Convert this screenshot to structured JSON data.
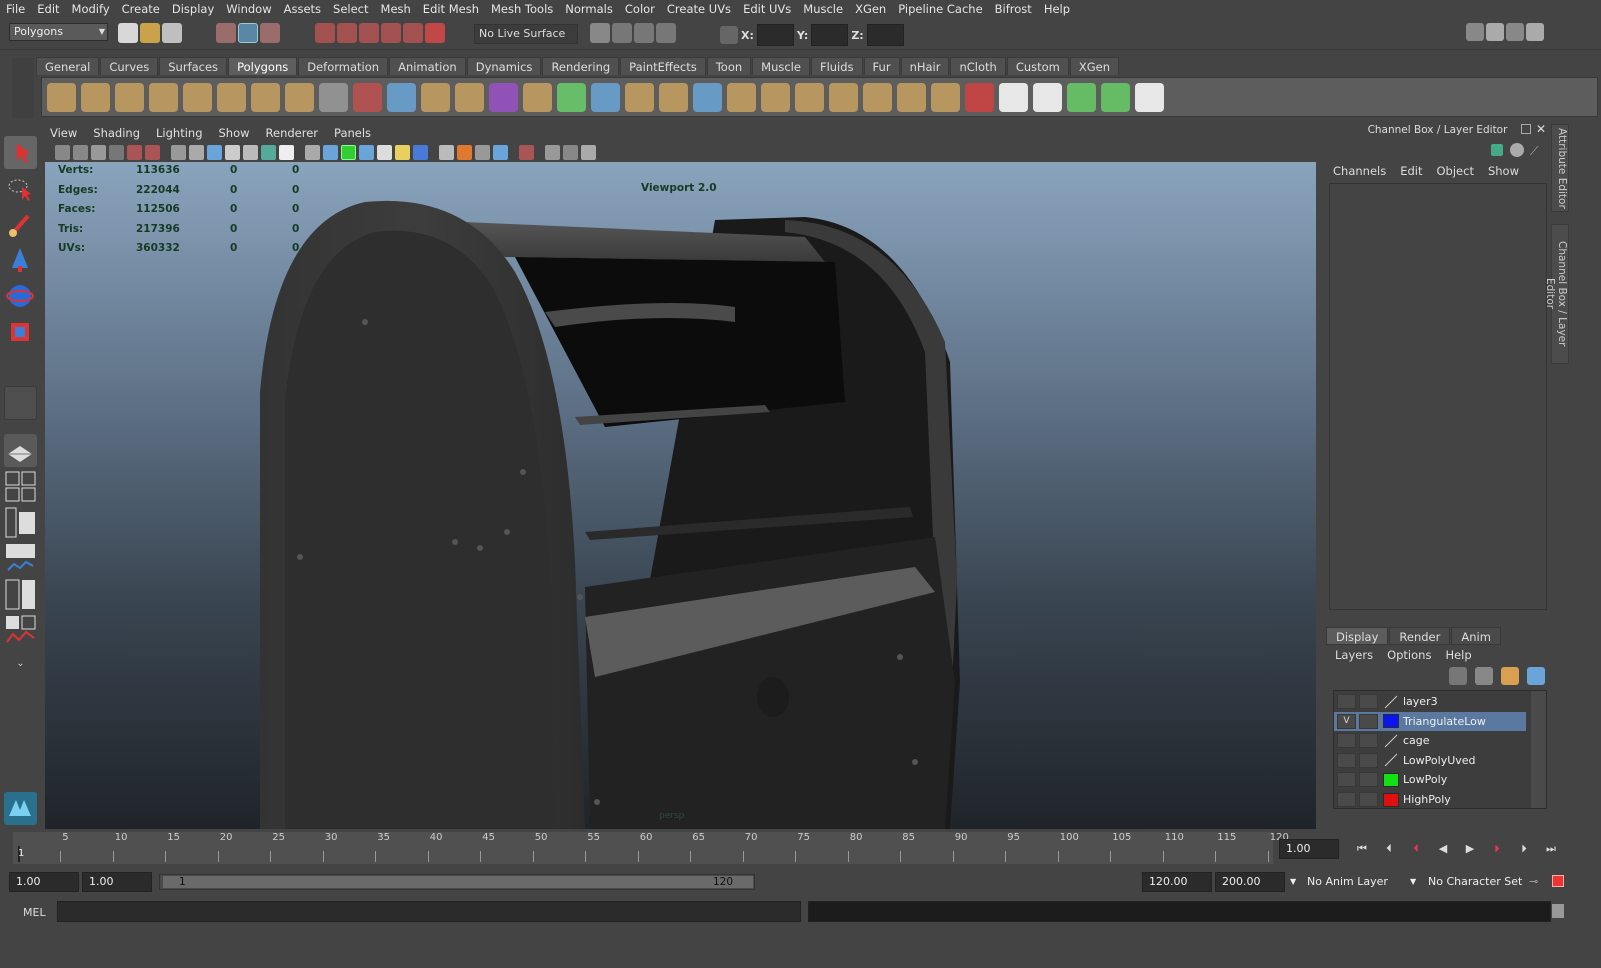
{
  "menubar": {
    "items": [
      "File",
      "Edit",
      "Modify",
      "Create",
      "Display",
      "Window",
      "Assets",
      "Select",
      "Mesh",
      "Edit Mesh",
      "Mesh Tools",
      "Normals",
      "Color",
      "Create UVs",
      "Edit UVs",
      "Muscle",
      "XGen",
      "Pipeline Cache",
      "Bifrost",
      "Help"
    ]
  },
  "statusline": {
    "mode": "Polygons",
    "live_surface": "No Live Surface",
    "x_label": "X:",
    "y_label": "Y:",
    "z_label": "Z:"
  },
  "shelf": {
    "tabs": [
      "General",
      "Curves",
      "Surfaces",
      "Polygons",
      "Deformation",
      "Animation",
      "Dynamics",
      "Rendering",
      "PaintEffects",
      "Toon",
      "Muscle",
      "Fluids",
      "Fur",
      "nHair",
      "nCloth",
      "Custom",
      "XGen"
    ],
    "active_tab": "Polygons"
  },
  "panel": {
    "menus": [
      "View",
      "Shading",
      "Lighting",
      "Show",
      "Renderer",
      "Panels"
    ]
  },
  "hud": {
    "rows": [
      {
        "label": "Verts:",
        "v1": "113636",
        "v2": "0",
        "v3": "0"
      },
      {
        "label": "Edges:",
        "v1": "222044",
        "v2": "0",
        "v3": "0"
      },
      {
        "label": "Faces:",
        "v1": "112506",
        "v2": "0",
        "v3": "0"
      },
      {
        "label": "Tris:",
        "v1": "217396",
        "v2": "0",
        "v3": "0"
      },
      {
        "label": "UVs:",
        "v1": "360332",
        "v2": "0",
        "v3": "0"
      }
    ],
    "viewport_label": "Viewport 2.0",
    "camera": "persp"
  },
  "channelbox": {
    "title": "Channel Box / Layer Editor",
    "menus": [
      "Channels",
      "Edit",
      "Object",
      "Show"
    ]
  },
  "layer_editor": {
    "tabs": [
      "Display",
      "Render",
      "Anim"
    ],
    "active_tab": "Display",
    "menus": [
      "Layers",
      "Options",
      "Help"
    ],
    "layers": [
      {
        "name": "layer3",
        "visible": "",
        "color": "none"
      },
      {
        "name": "TriangulateLow",
        "visible": "V",
        "color": "#0a14f0",
        "selected": true
      },
      {
        "name": "cage",
        "visible": "",
        "color": "none"
      },
      {
        "name": "LowPolyUved",
        "visible": "",
        "color": "none"
      },
      {
        "name": "LowPoly",
        "visible": "",
        "color": "#12e012"
      },
      {
        "name": "HighPoly",
        "visible": "",
        "color": "#e01010"
      }
    ]
  },
  "sidetabs": {
    "attribute_editor": "Attribute Editor",
    "channel_box": "Channel Box / Layer Editor"
  },
  "timeline": {
    "ticks": [
      "5",
      "10",
      "15",
      "20",
      "25",
      "30",
      "35",
      "40",
      "45",
      "50",
      "55",
      "60",
      "65",
      "70",
      "75",
      "80",
      "85",
      "90",
      "95",
      "100",
      "105",
      "110",
      "115",
      "120"
    ],
    "current_marker": "1",
    "current_frame": "1.00"
  },
  "range": {
    "start": "1.00",
    "anim_start": "1.00",
    "slider_start": "1",
    "slider_end": "120",
    "end": "120.00",
    "anim_end": "200.00",
    "anim_layer": "No Anim Layer",
    "char_set": "No Character Set"
  },
  "cmd": {
    "label": "MEL"
  },
  "colors": {
    "accent": "#5b79a0",
    "bg": "#444444"
  }
}
